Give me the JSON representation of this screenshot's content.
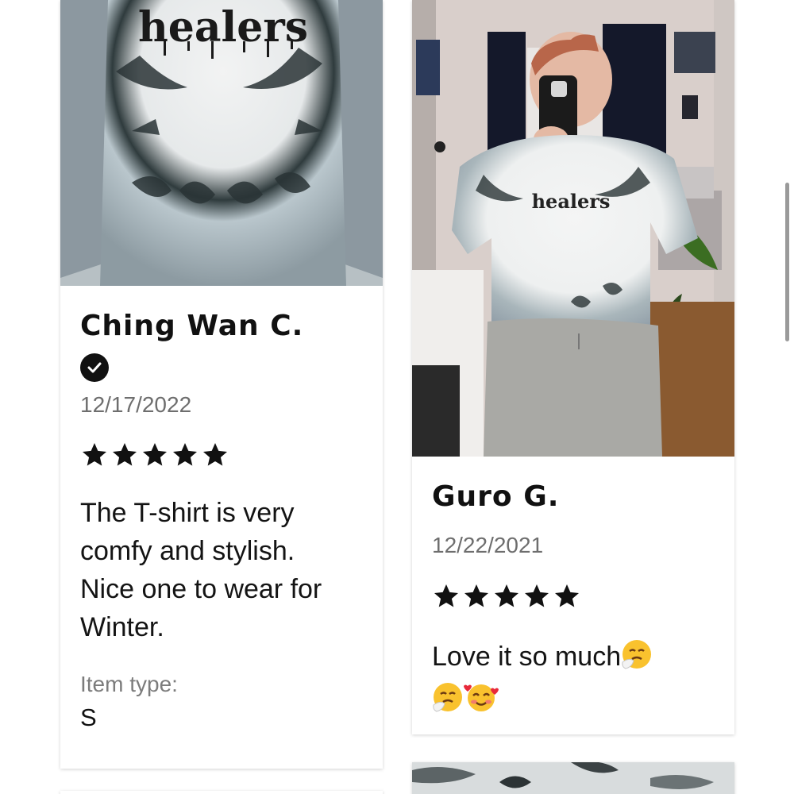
{
  "reviews": [
    {
      "name": "Ching Wan C.",
      "verified": true,
      "date": "12/17/2022",
      "rating": 5,
      "text": "The T-shirt is very comfy and stylish. Nice one to wear for Winter.",
      "item_type_label": "Item type:",
      "item_type_value": "S",
      "photo_caption": "healers"
    },
    {
      "name": "Guro G.",
      "verified": false,
      "date": "12/22/2021",
      "rating": 5,
      "text": "Love it so much",
      "emojis": [
        "sneezing-face",
        "sneezing-face",
        "smiling-face-with-hearts"
      ],
      "photo_caption": "healers"
    }
  ],
  "colors": {
    "star": "#111111",
    "date": "#6e6e6e",
    "label": "#7c7c7c",
    "card_bg": "#ffffff"
  }
}
